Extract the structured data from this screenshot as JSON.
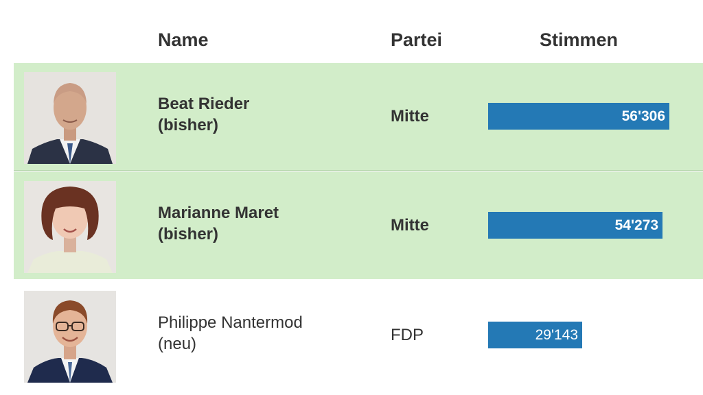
{
  "header": {
    "name_label": "Name",
    "party_label": "Partei",
    "votes_label": "Stimmen"
  },
  "colors": {
    "elected_row": "#d2edc9",
    "bar": "#2479b5"
  },
  "rows": [
    {
      "name_line1": "Beat Rieder",
      "name_line2": "(bisher)",
      "party": "Mitte",
      "votes_label": "56'306",
      "elected": true
    },
    {
      "name_line1": "Marianne Maret",
      "name_line2": "(bisher)",
      "party": "Mitte",
      "votes_label": "54'273",
      "elected": true
    },
    {
      "name_line1": "Philippe Nantermod",
      "name_line2": "(neu)",
      "party": "FDP",
      "votes_label": "29'143",
      "elected": false
    }
  ],
  "chart_data": {
    "type": "bar",
    "categories": [
      "Beat Rieder",
      "Marianne Maret",
      "Philippe Nantermod"
    ],
    "values": [
      56306,
      54273,
      29143
    ],
    "xlabel": "",
    "ylabel": "Stimmen"
  }
}
